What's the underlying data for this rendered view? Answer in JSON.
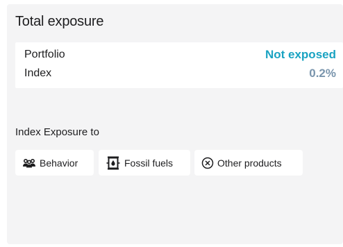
{
  "card": {
    "title": "Total exposure"
  },
  "exposure": {
    "rows": [
      {
        "label": "Portfolio",
        "value": "Not exposed",
        "color": "#1aa3c2"
      },
      {
        "label": "Index",
        "value": "0.2%",
        "color": "#7a95ad"
      }
    ]
  },
  "index_exposure": {
    "label": "Index Exposure to",
    "chips": [
      {
        "label": "Behavior",
        "icon": "people-group-icon"
      },
      {
        "label": "Fossil fuels",
        "icon": "oil-barrel-icon"
      },
      {
        "label": "Other products",
        "icon": "circle-x-icon"
      }
    ]
  }
}
